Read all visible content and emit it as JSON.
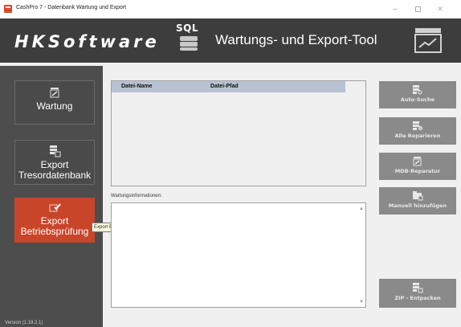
{
  "window": {
    "title": "CashPro 7 - Datenbank Wartung und Export",
    "minimize_glyph": "–",
    "close_glyph": "✕"
  },
  "header": {
    "brand": "HKSoftware",
    "sql_label": "SQL",
    "title": "Wartungs- und Export-Tool"
  },
  "sidebar": {
    "items": [
      {
        "label": "Wartung",
        "icon": "wrench-doc-icon"
      },
      {
        "label_line1": "Export",
        "label_line2": "Tresordatenbank",
        "icon": "database-export-icon"
      },
      {
        "label_line1": "Export",
        "label_line2": "Betriebsprüfung",
        "icon": "audit-export-icon"
      }
    ],
    "version": "Version (1.19.2.1)"
  },
  "tooltip": "Export Betriebsprüfung",
  "table": {
    "columns": [
      "Datei-Name",
      "Datei-Pfad"
    ]
  },
  "info": {
    "label": "Wartungsinformationen:"
  },
  "actions": {
    "auto_search": "Auto-Suche",
    "repair_all": "Alle Reparieren",
    "mdb_repair": "MDB-Reparatur",
    "add_manual": "Manuell hinzufügen",
    "zip_extract": "ZIP - Entpacken"
  },
  "colors": {
    "header_bg": "#3d3d3d",
    "sidebar_bg": "#4d4d4d",
    "active_accent": "#c8452a",
    "action_button_bg": "#8a8a8a",
    "table_header_bg": "#b8c2d4"
  }
}
